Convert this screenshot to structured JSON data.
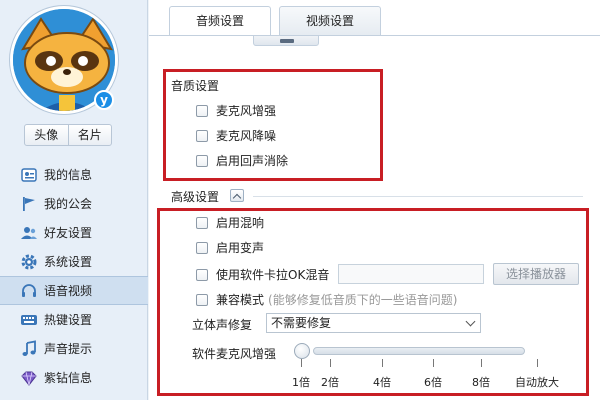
{
  "sidebar": {
    "avatar_buttons": [
      "头像",
      "名片"
    ],
    "items": [
      {
        "label": "我的信息",
        "icon": "user-card-icon",
        "active": false
      },
      {
        "label": "我的公会",
        "icon": "flag-icon",
        "active": false
      },
      {
        "label": "好友设置",
        "icon": "friends-icon",
        "active": false
      },
      {
        "label": "系统设置",
        "icon": "gear-icon",
        "active": false
      },
      {
        "label": "语音视频",
        "icon": "headset-icon",
        "active": true
      },
      {
        "label": "热键设置",
        "icon": "keyboard-icon",
        "active": false
      },
      {
        "label": "声音提示",
        "icon": "music-note-icon",
        "active": false
      },
      {
        "label": "紫钻信息",
        "icon": "diamond-icon",
        "active": false
      }
    ]
  },
  "tabs": [
    {
      "label": "音频设置",
      "active": true
    },
    {
      "label": "视频设置",
      "active": false
    }
  ],
  "audio_quality": {
    "title": "音质设置",
    "options": [
      "麦克风增强",
      "麦克风降噪",
      "启用回声消除"
    ]
  },
  "advanced": {
    "title": "高级设置",
    "options": [
      "启用混响",
      "启用变声",
      "使用软件卡拉OK混音"
    ],
    "select_player_button": "选择播放器",
    "compat_mode_label": "兼容模式",
    "compat_mode_hint": "(能够修复低音质下的一些语音问题)",
    "stereo_label": "立体声修复",
    "stereo_value": "不需要修复",
    "mic_boost_label": "软件麦克风增强",
    "mic_boost_level": 0,
    "slider_ticks": [
      "1倍",
      "2倍",
      "4倍",
      "6倍",
      "8倍",
      "自动放大"
    ]
  },
  "colors": {
    "highlight_box": "#c81e24",
    "active_nav_bg": "#cfdff0"
  }
}
